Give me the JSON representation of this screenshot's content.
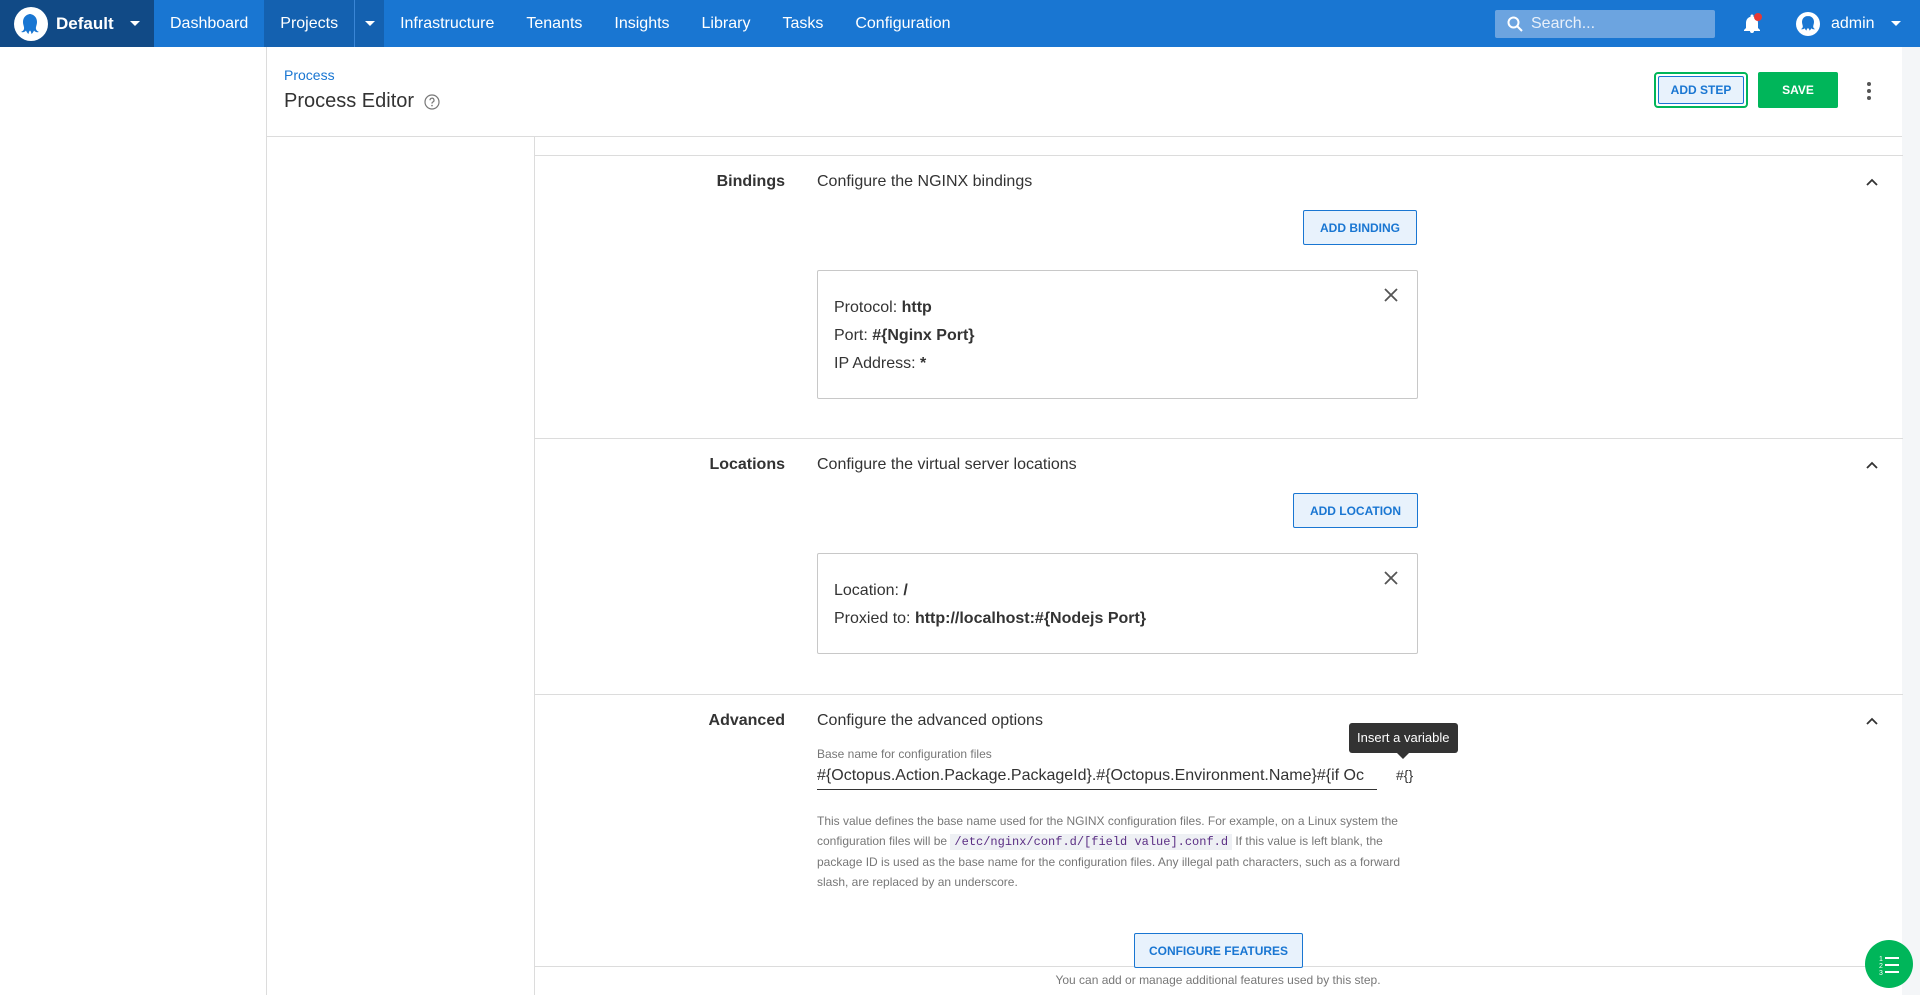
{
  "nav": {
    "space": "Default",
    "items": [
      "Dashboard",
      "Projects",
      "Infrastructure",
      "Tenants",
      "Insights",
      "Library",
      "Tasks",
      "Configuration"
    ],
    "active": "Projects",
    "search_placeholder": "Search...",
    "user": "admin"
  },
  "header": {
    "breadcrumb": "Process",
    "title": "Process Editor",
    "add_step": "ADD STEP",
    "save": "SAVE"
  },
  "bindings": {
    "label": "Bindings",
    "description": "Configure the NGINX bindings",
    "add_button": "ADD BINDING",
    "card": [
      {
        "key": "Protocol:",
        "value": "http"
      },
      {
        "key": "Port:",
        "value": "#{Nginx Port}"
      },
      {
        "key": "IP Address:",
        "value": "*"
      }
    ]
  },
  "locations": {
    "label": "Locations",
    "description": "Configure the virtual server locations",
    "add_button": "ADD LOCATION",
    "card": [
      {
        "key": "Location:",
        "value": "/"
      },
      {
        "key": "Proxied to:",
        "value": "http://localhost:#{Nodejs Port}"
      }
    ]
  },
  "advanced": {
    "label": "Advanced",
    "description": "Configure the advanced options",
    "field_label": "Base name for configuration files",
    "field_value": "#{Octopus.Action.Package.PackageId}.#{Octopus.Environment.Name}#{if Oc",
    "variable_button": "#{}",
    "tooltip": "Insert a variable",
    "help_pre": "This value defines the base name used for the NGINX configuration files. For example, on a Linux system the configuration files will be",
    "help_code": "/etc/nginx/conf.d/[field value].conf.d",
    "help_post": "If this value is left blank, the package ID is used as the base name for the configuration files. Any illegal path characters, such as a forward slash, are replaced by an underscore."
  },
  "features": {
    "button": "CONFIGURE FEATURES",
    "hint": "You can add or manage additional features used by this step."
  },
  "colors": {
    "nav": "#1976d2",
    "space": "#114a86",
    "accent": "#00b65a"
  }
}
